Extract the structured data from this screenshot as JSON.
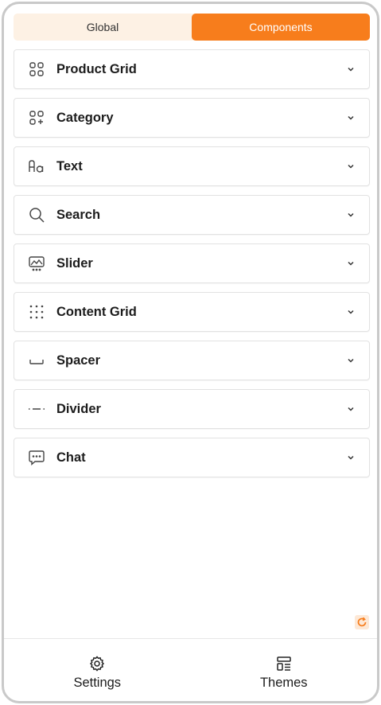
{
  "tabs": [
    {
      "label": "Global",
      "active": false
    },
    {
      "label": "Components",
      "active": true
    }
  ],
  "components": [
    {
      "label": "Product Grid",
      "icon": "grid-icon"
    },
    {
      "label": "Category",
      "icon": "category-icon"
    },
    {
      "label": "Text",
      "icon": "text-icon"
    },
    {
      "label": "Search",
      "icon": "search-icon"
    },
    {
      "label": "Slider",
      "icon": "slider-icon"
    },
    {
      "label": "Content Grid",
      "icon": "dots-grid-icon"
    },
    {
      "label": "Spacer",
      "icon": "spacer-icon"
    },
    {
      "label": "Divider",
      "icon": "divider-icon"
    },
    {
      "label": "Chat",
      "icon": "chat-icon"
    }
  ],
  "bottom_nav": {
    "settings_label": "Settings",
    "themes_label": "Themes"
  },
  "colors": {
    "accent": "#f77d1c",
    "tab_bg": "#fdf1e4",
    "refresh_bg": "#fde8d6"
  }
}
